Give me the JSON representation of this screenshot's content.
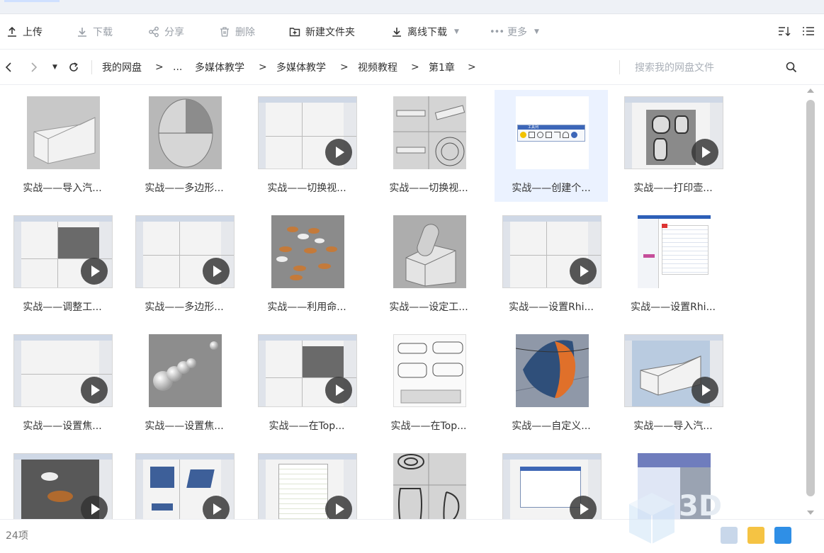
{
  "toolbar": {
    "upload": "上传",
    "download": "下载",
    "share": "分享",
    "delete": "删除",
    "new_folder": "新建文件夹",
    "offline_download": "离线下载",
    "more": "更多"
  },
  "nav": {
    "crumbs": [
      "我的网盘",
      "...",
      "多媒体教学",
      "多媒体教学",
      "视频教程",
      "第1章"
    ],
    "separator": ">",
    "search_placeholder": "搜索我的网盘文件"
  },
  "files": [
    {
      "name": "实战——导入汽...",
      "video": false
    },
    {
      "name": "实战——多边形...",
      "video": false
    },
    {
      "name": "实战——切换视...",
      "video": true
    },
    {
      "name": "实战——切换视...",
      "video": false
    },
    {
      "name": "实战——创建个...",
      "video": false,
      "selected": true
    },
    {
      "name": "实战——打印壶...",
      "video": true
    },
    {
      "name": "实战——调整工...",
      "video": true
    },
    {
      "name": "实战——多边形...",
      "video": true
    },
    {
      "name": "实战——利用命...",
      "video": false
    },
    {
      "name": "实战——设定工...",
      "video": false
    },
    {
      "name": "实战——设置Rhi...",
      "video": true
    },
    {
      "name": "实战——设置Rhi...",
      "video": false
    },
    {
      "name": "实战——设置焦...",
      "video": true
    },
    {
      "name": "实战——设置焦...",
      "video": false
    },
    {
      "name": "实战——在Top...",
      "video": true
    },
    {
      "name": "实战——在Top...",
      "video": false
    },
    {
      "name": "实战——自定义...",
      "video": false
    },
    {
      "name": "实战——导入汽...",
      "video": true
    },
    {
      "name": "",
      "video": true
    },
    {
      "name": "",
      "video": true
    },
    {
      "name": "",
      "video": true
    },
    {
      "name": "",
      "video": false
    },
    {
      "name": "",
      "video": true
    },
    {
      "name": "",
      "video": false
    }
  ],
  "toolbox_label": "工具列",
  "status": {
    "count": "24项"
  },
  "watermark": "3D",
  "colors": {
    "accent": "#06a7ff",
    "selected_bg": "#ebf2ff"
  }
}
